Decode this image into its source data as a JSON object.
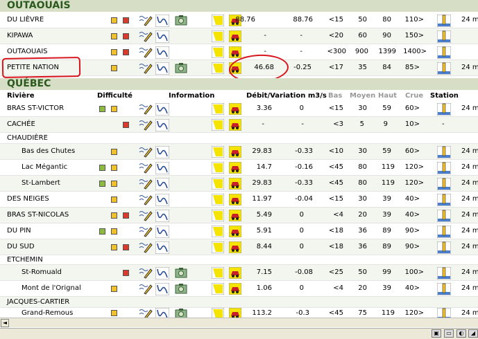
{
  "sections": {
    "outaouais": "OUTAOUAIS",
    "quebec": "QUÉBEC"
  },
  "headers": {
    "riviere": "Rivière",
    "difficulte": "Difficulté",
    "information": "Information",
    "debit": "Débit/Variation m3/s",
    "bas": "Bas",
    "moyen": "Moyen",
    "haut": "Haut",
    "crue": "Crue",
    "station": "Station"
  },
  "rows": [
    {
      "name": "DU LIÈVRE",
      "debit": "88.76",
      "variation": "88.76",
      "bas": "<15",
      "moyen": "50",
      "haut": "80",
      "crue": "110>",
      "time": "24 m"
    },
    {
      "name": "KIPAWA",
      "debit": "-",
      "variation": "-",
      "bas": "<20",
      "moyen": "60",
      "haut": "90",
      "crue": "150>",
      "time": ""
    },
    {
      "name": "OUTAOUAIS",
      "debit": "-",
      "variation": "-",
      "bas": "<300",
      "moyen": "900",
      "haut": "1399",
      "crue": "1400>",
      "time": ""
    },
    {
      "name": "PETITE NATION",
      "debit": "46.68",
      "variation": "-0.25",
      "bas": "<17",
      "moyen": "35",
      "haut": "84",
      "crue": "85>",
      "time": "24 m"
    },
    {
      "name": "BRAS ST-VICTOR",
      "debit": "3.36",
      "variation": "0",
      "bas": "<15",
      "moyen": "30",
      "haut": "59",
      "crue": "60>",
      "time": "24 m"
    },
    {
      "name": "CACHÉE",
      "debit": "-",
      "variation": "-",
      "bas": "<3",
      "moyen": "5",
      "haut": "9",
      "crue": "10>",
      "time": "-"
    },
    {
      "name": "CHAUDIÈRE"
    },
    {
      "name": "Bas des Chutes",
      "debit": "29.83",
      "variation": "-0.33",
      "bas": "<10",
      "moyen": "30",
      "haut": "59",
      "crue": "60>",
      "time": "24 m"
    },
    {
      "name": "Lac Mégantic",
      "debit": "14.7",
      "variation": "-0.16",
      "bas": "<45",
      "moyen": "80",
      "haut": "119",
      "crue": "120>",
      "time": "24 m"
    },
    {
      "name": "St-Lambert",
      "debit": "29.83",
      "variation": "-0.33",
      "bas": "<45",
      "moyen": "80",
      "haut": "119",
      "crue": "120>",
      "time": "24 m"
    },
    {
      "name": "DES NEIGES",
      "debit": "11.97",
      "variation": "-0.04",
      "bas": "<15",
      "moyen": "30",
      "haut": "39",
      "crue": "40>",
      "time": "24 m"
    },
    {
      "name": "BRAS ST-NICOLAS",
      "debit": "5.49",
      "variation": "0",
      "bas": "<4",
      "moyen": "20",
      "haut": "39",
      "crue": "40>",
      "time": "24 m"
    },
    {
      "name": "DU PIN",
      "debit": "5.91",
      "variation": "0",
      "bas": "<18",
      "moyen": "36",
      "haut": "89",
      "crue": "90>",
      "time": "24 m"
    },
    {
      "name": "DU SUD",
      "debit": "8.44",
      "variation": "0",
      "bas": "<18",
      "moyen": "36",
      "haut": "89",
      "crue": "90>",
      "time": "24 m"
    },
    {
      "name": "ETCHEMIN"
    },
    {
      "name": "St-Romuald",
      "debit": "7.15",
      "variation": "-0.08",
      "bas": "<25",
      "moyen": "50",
      "haut": "99",
      "crue": "100>",
      "time": "24 m"
    },
    {
      "name": "Mont de l'Orignal",
      "debit": "1.06",
      "variation": "0",
      "bas": "<4",
      "moyen": "20",
      "haut": "39",
      "crue": "40>",
      "time": "24 m"
    },
    {
      "name": "JACQUES-CARTIER"
    },
    {
      "name": "Grand-Remous",
      "debit": "113.2",
      "variation": "-0.3",
      "bas": "<45",
      "moyen": "75",
      "haut": "119",
      "crue": "120>",
      "time": "24 m"
    }
  ],
  "colors": {
    "section_bg": "#d6dfc5",
    "section_text": "#2c5a1e",
    "annotation": "#d8141c",
    "yellow": "#f2c12a",
    "red": "#d93a2a",
    "green": "#8dbb3f"
  }
}
